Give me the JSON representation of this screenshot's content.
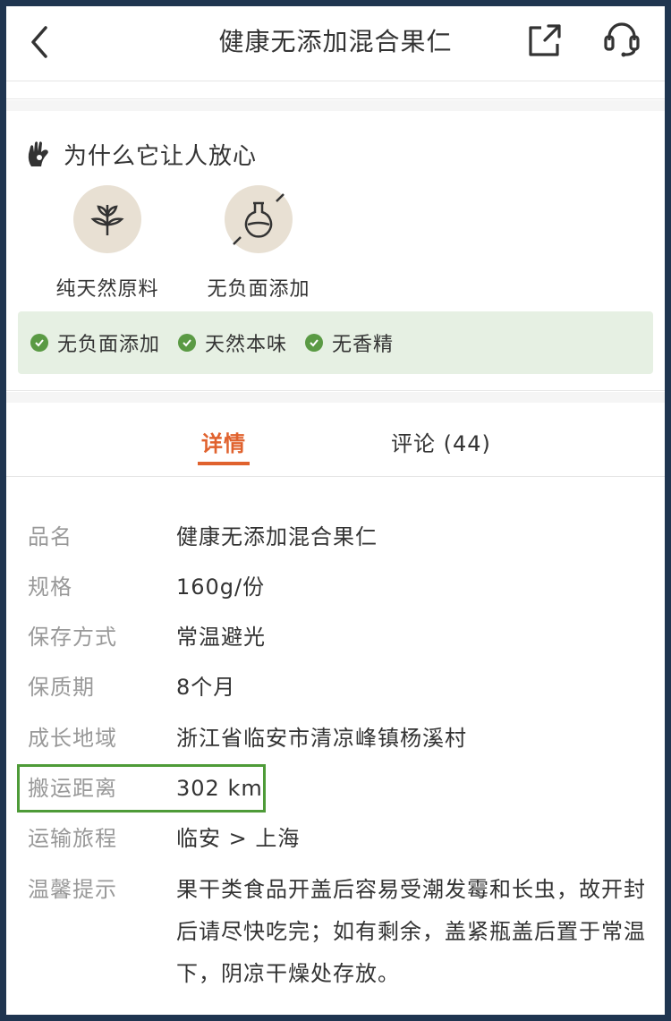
{
  "header": {
    "title": "健康无添加混合果仁"
  },
  "why": {
    "title": "为什么它让人放心",
    "features": [
      {
        "label": "纯天然原料",
        "icon": "plant-icon"
      },
      {
        "label": "无负面添加",
        "icon": "flask-crossed-icon"
      }
    ],
    "tags": [
      "无负面添加",
      "天然本味",
      "无香精"
    ]
  },
  "tabs": {
    "details": "详情",
    "reviews": "评论 (44)"
  },
  "details": {
    "rows": [
      {
        "key": "品名",
        "value": "健康无添加混合果仁"
      },
      {
        "key": "规格",
        "value": "160g/份"
      },
      {
        "key": "保存方式",
        "value": "常温避光"
      },
      {
        "key": "保质期",
        "value": "8个月"
      },
      {
        "key": "成长地域",
        "value": "浙江省临安市清凉峰镇杨溪村"
      },
      {
        "key": "搬运距离",
        "value": "302 km"
      },
      {
        "key": "运输旅程",
        "value": "临安 > 上海"
      },
      {
        "key": "温馨提示",
        "value": "果干类食品开盖后容易受潮发霉和长虫，故开封后请尽快吃完；如有剩余，盖紧瓶盖后置于常温下，阴凉干燥处存放。"
      }
    ]
  },
  "colors": {
    "accent": "#e0622e",
    "tag_bg": "#e6f0e3",
    "check": "#5a9a44",
    "highlight": "#4e9b38"
  }
}
